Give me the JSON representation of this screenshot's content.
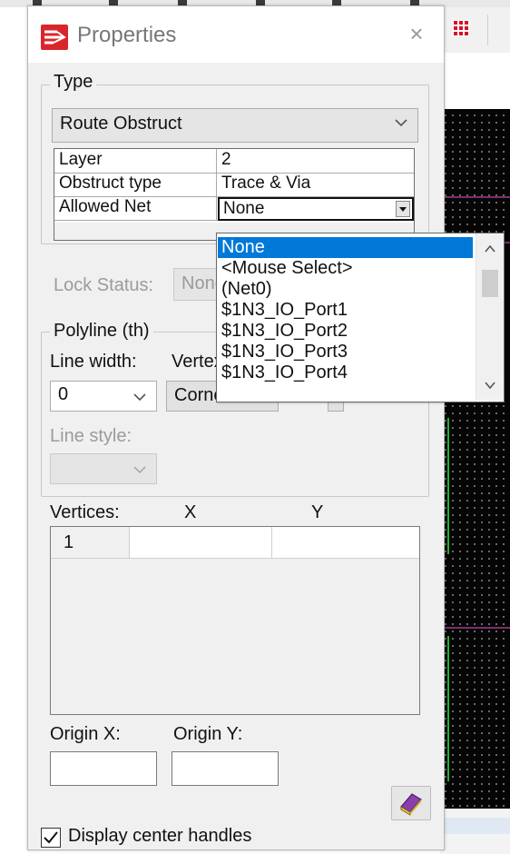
{
  "window": {
    "title": "Properties",
    "close_glyph": "×"
  },
  "type_group": {
    "label": "Type",
    "selected": "Route Obstruct"
  },
  "properties": [
    {
      "name": "Layer",
      "value": "2"
    },
    {
      "name": "Obstruct type",
      "value": "Trace & Via"
    },
    {
      "name": "Allowed Net",
      "value": "None"
    }
  ],
  "allowed_net_options": [
    "None",
    "<Mouse Select>",
    "(Net0)",
    "$1N3_IO_Port1",
    "$1N3_IO_Port2",
    "$1N3_IO_Port3",
    "$1N3_IO_Port4"
  ],
  "allowed_net_selected_index": 0,
  "lock_status": {
    "label": "Lock Status:",
    "value": "None"
  },
  "polyline_group": {
    "label": "Polyline (th)",
    "line_width_label": "Line width:",
    "line_width_value": "0",
    "vertex_label": "Vertex",
    "vertex_button": "Corner",
    "line_style_label": "Line style:"
  },
  "vertices": {
    "label": "Vertices:",
    "x_header": "X",
    "y_header": "Y",
    "rows": [
      {
        "index": "1",
        "x": "",
        "y": ""
      }
    ]
  },
  "origin": {
    "x_label": "Origin X:",
    "y_label": "Origin Y:",
    "x_value": "",
    "y_value": ""
  },
  "display_center_handles": {
    "label": "Display center handles",
    "checked": true
  },
  "colors": {
    "accent_selection": "#0078d7",
    "canvas": "#050505",
    "trace_green": "#27b02a",
    "trace_purple": "#7d2f6c"
  },
  "icons": [
    "properties-app-icon",
    "close-icon",
    "chevron-down-icon",
    "grid-toolbar-icon",
    "help-book-icon",
    "checkmark-icon"
  ]
}
